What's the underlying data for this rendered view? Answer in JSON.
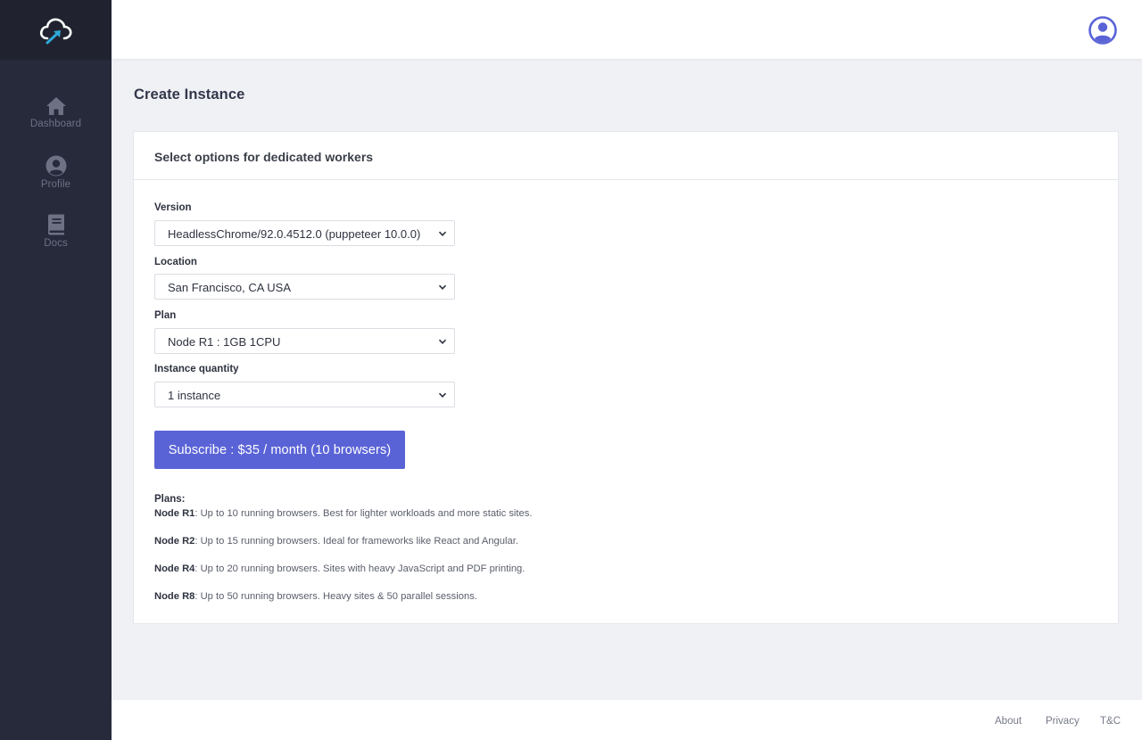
{
  "sidebar": {
    "items": [
      {
        "label": "Dashboard",
        "icon": "home-icon"
      },
      {
        "label": "Profile",
        "icon": "user-circle-icon"
      },
      {
        "label": "Docs",
        "icon": "book-icon"
      }
    ]
  },
  "page": {
    "title": "Create Instance"
  },
  "card": {
    "header": "Select options for dedicated workers"
  },
  "form": {
    "version": {
      "label": "Version",
      "value": "HeadlessChrome/92.0.4512.0 (puppeteer 10.0.0)"
    },
    "location": {
      "label": "Location",
      "value": "San Francisco, CA USA"
    },
    "plan": {
      "label": "Plan",
      "value": "Node R1 : 1GB 1CPU"
    },
    "quantity": {
      "label": "Instance quantity",
      "value": "1 instance"
    }
  },
  "subscribe": {
    "label": "Subscribe : $35 / month (10 browsers)"
  },
  "plans": {
    "title": "Plans:",
    "items": [
      {
        "name": "Node R1",
        "desc": ": Up to 10 running browsers. Best for lighter workloads and more static sites."
      },
      {
        "name": "Node R2",
        "desc": ": Up to 15 running browsers. Ideal for frameworks like React and Angular."
      },
      {
        "name": "Node R4",
        "desc": ": Up to 20 running browsers. Sites with heavy JavaScript and PDF printing."
      },
      {
        "name": "Node R8",
        "desc": ": Up to 50 running browsers. Heavy sites & 50 parallel sessions."
      }
    ]
  },
  "footer": {
    "links": [
      "About",
      "Privacy",
      "T&C"
    ]
  },
  "colors": {
    "sidebar": "#262a3a",
    "accent": "#5a63d6",
    "background": "#f0f1f5"
  }
}
